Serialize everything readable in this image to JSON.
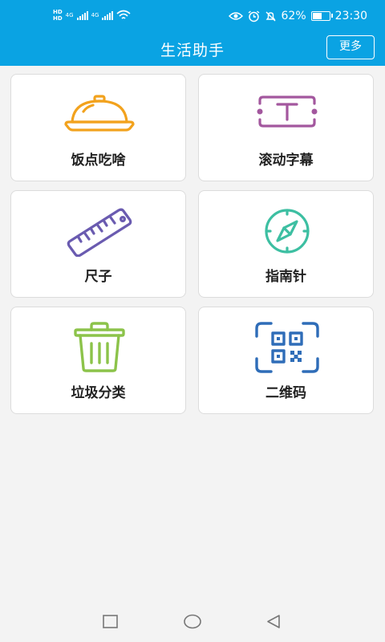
{
  "status_bar": {
    "network_left": [
      "HD",
      "HD"
    ],
    "network_type": "4G",
    "battery": "62%",
    "battery_level": 0.62,
    "time": "23:30"
  },
  "app_bar": {
    "title": "生活助手",
    "more_label": "更多"
  },
  "tools": [
    {
      "label": "饭点吃啥",
      "icon": "food-cloche-icon",
      "color": "#f2a21d"
    },
    {
      "label": "滚动字幕",
      "icon": "scrolling-text-icon",
      "color": "#a3579e"
    },
    {
      "label": "尺子",
      "icon": "ruler-icon",
      "color": "#6a5bb0"
    },
    {
      "label": "指南针",
      "icon": "compass-icon",
      "color": "#3dbfa2"
    },
    {
      "label": "垃圾分类",
      "icon": "trash-can-icon",
      "color": "#8cc34a"
    },
    {
      "label": "二维码",
      "icon": "qr-code-icon",
      "color": "#2f6db8"
    }
  ],
  "nav": {
    "buttons": [
      "recent-apps",
      "home",
      "back"
    ]
  },
  "colors": {
    "app_bar": "#0aa3e3",
    "background": "#f3f3f3"
  }
}
